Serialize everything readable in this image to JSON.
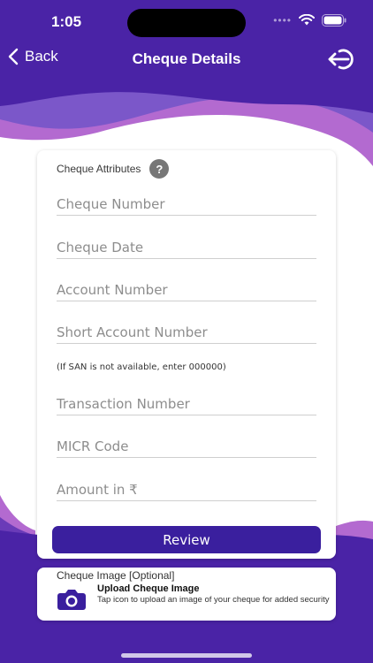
{
  "status_bar": {
    "time": "1:05"
  },
  "nav": {
    "back_label": "Back",
    "title": "Cheque Details"
  },
  "card": {
    "header": "Cheque Attributes",
    "help": "?",
    "fields": {
      "cheque_number": "Cheque Number",
      "cheque_date": "Cheque Date",
      "account_number": "Account Number",
      "short_account_number": "Short Account Number",
      "transaction_number": "Transaction Number",
      "micr_code": "MICR Code",
      "amount": "Amount in ₹"
    },
    "san_hint": "(If SAN is not available, enter 000000)",
    "review_label": "Review"
  },
  "upload": {
    "label": "Cheque Image [Optional]",
    "title": "Upload Cheque Image",
    "description": "Tap icon to upload an image of your cheque for added security"
  },
  "colors": {
    "primary_purple": "#4a23a6",
    "wave_pink": "#b061c7",
    "button": "#3a1f9e"
  },
  "icons": {
    "back": "chevron-left-icon",
    "logout": "logout-icon",
    "help": "question-mark-icon",
    "camera": "camera-icon",
    "wifi": "wifi-icon",
    "battery": "battery-icon"
  }
}
